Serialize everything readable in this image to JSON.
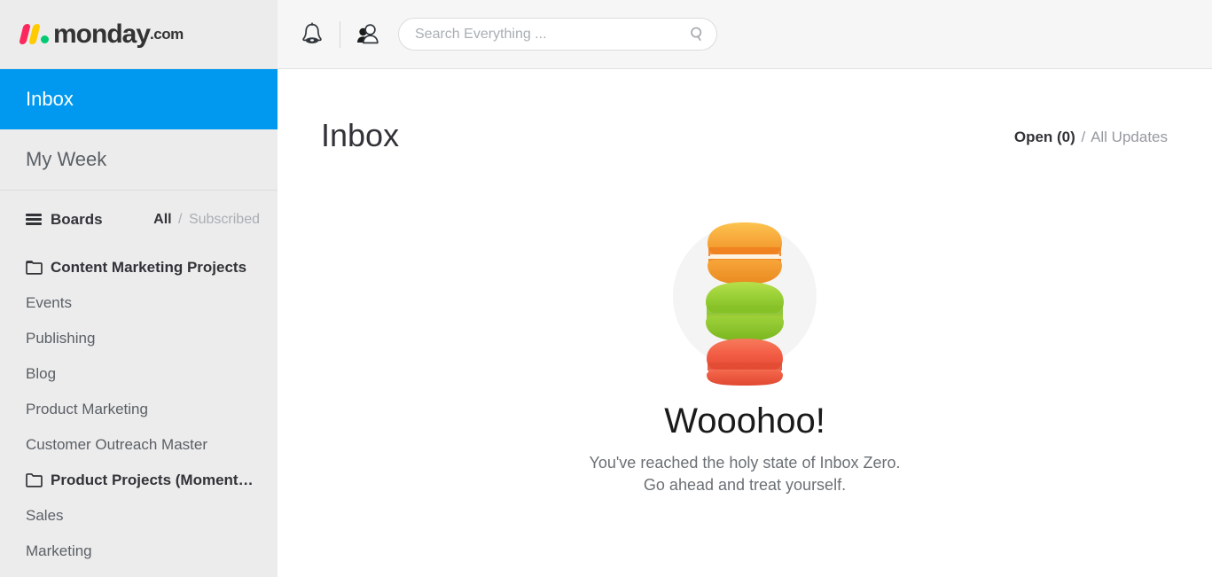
{
  "brand": {
    "name": "monday",
    "tld": ".com",
    "colors": {
      "slash_red": "#fb275d",
      "slash_yellow": "#ffcb00",
      "dot_green": "#00ca72",
      "accent_blue": "#0099ef"
    }
  },
  "header": {
    "notifications_icon": "bell-icon",
    "invite_icon": "people-icon",
    "search": {
      "placeholder": "Search Everything ...",
      "value": "",
      "icon": "search-icon"
    }
  },
  "sidebar": {
    "primary": [
      {
        "label": "Inbox",
        "active": true
      },
      {
        "label": "My Week",
        "active": false
      }
    ],
    "boards_section": {
      "title": "Boards",
      "menu_icon": "hamburger-icon",
      "filter_active": "All",
      "filter_separator": "/",
      "filter_inactive": "Subscribed"
    },
    "boards": [
      {
        "label": "Content Marketing Projects",
        "type": "folder",
        "icon": "folder-open-icon"
      },
      {
        "label": "Events",
        "type": "board"
      },
      {
        "label": "Publishing",
        "type": "board"
      },
      {
        "label": "Blog",
        "type": "board"
      },
      {
        "label": "Product Marketing",
        "type": "board"
      },
      {
        "label": "Customer Outreach Master",
        "type": "board"
      },
      {
        "label": "Product Projects (Momentu…",
        "type": "folder",
        "icon": "folder-icon"
      },
      {
        "label": "Sales",
        "type": "board"
      },
      {
        "label": "Marketing",
        "type": "board"
      }
    ]
  },
  "main": {
    "title": "Inbox",
    "tabs": {
      "active": "Open (0)",
      "separator": "/",
      "inactive": "All Updates"
    },
    "empty_state": {
      "illustration": "macaron-stack-illustration",
      "heading": "Wooohoo!",
      "line1": "You've reached the holy state of Inbox Zero.",
      "line2": "Go ahead and treat yourself."
    }
  }
}
